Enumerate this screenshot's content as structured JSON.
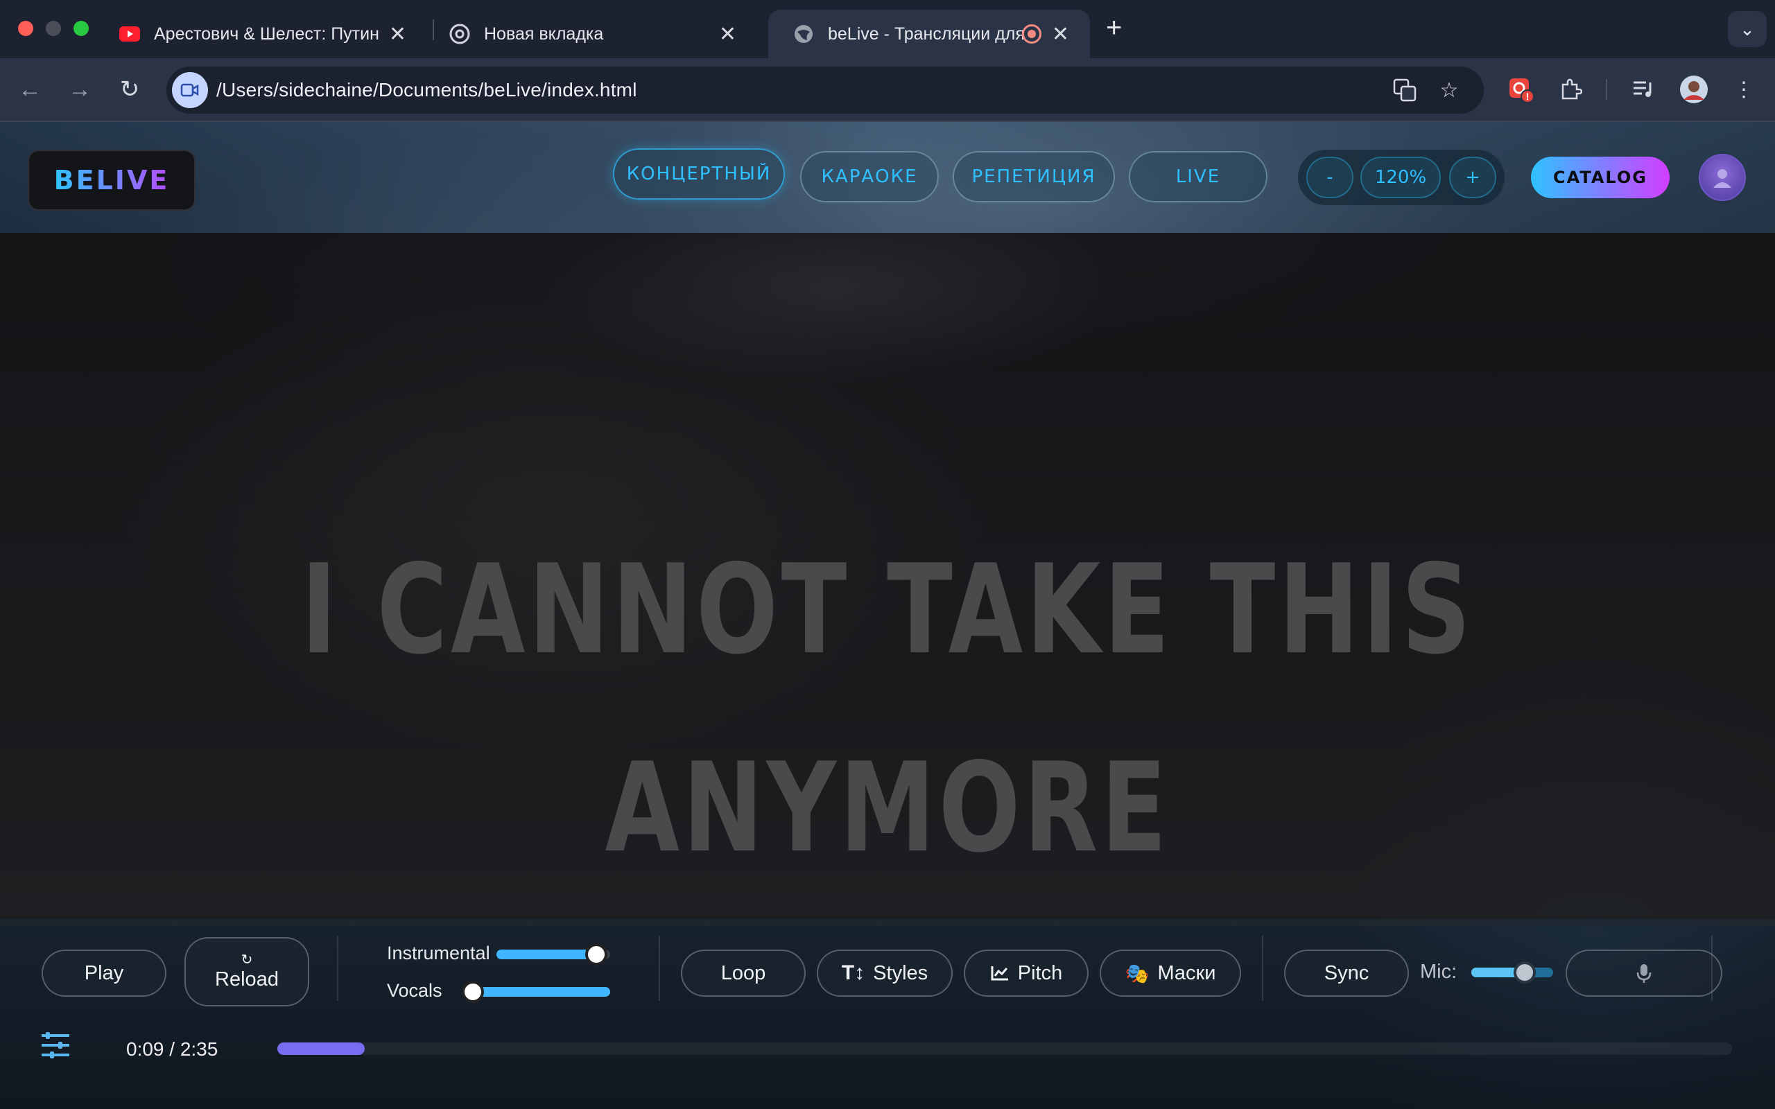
{
  "browser": {
    "tabs": [
      {
        "title": "Арестович & Шелест: Путин",
        "active": false,
        "favicon": "youtube-icon"
      },
      {
        "title": "Новая вкладка",
        "active": false,
        "favicon": "chrome-icon"
      },
      {
        "title": "beLive - Трансляции для",
        "active": true,
        "favicon": "globe-icon"
      }
    ],
    "url": "/Users/sidechaine/Documents/beLive/index.html"
  },
  "header": {
    "logo": "BELIVE",
    "modes": [
      "КОНЦЕРТНЫЙ",
      "КАРАОКЕ",
      "РЕПЕТИЦИЯ",
      "LIVE"
    ],
    "active_mode": "КОНЦЕРТНЫЙ",
    "zoom": {
      "minus": "-",
      "value": "120%",
      "plus": "+"
    },
    "catalog": "CATALOG"
  },
  "lyrics": {
    "line1": "I CANNOT TAKE THIS",
    "line2": "ANYMORE"
  },
  "controls": {
    "play": "Play",
    "reload_icon": "↻",
    "reload": "Reload",
    "instrumental_label": "Instrumental",
    "instrumental_level": 0.88,
    "vocals_label": "Vocals",
    "vocals_level": 0.02,
    "loop": "Loop",
    "styles": "Styles",
    "pitch": "Pitch",
    "masks": "Маски",
    "sync": "Sync",
    "mic_label": "Mic:",
    "mic_level": 0.65,
    "time": "0:09 / 2:35",
    "progress": 0.06
  },
  "colors": {
    "accent": "#2fc0ff",
    "catalog_gradient_start": "#2ec3ff",
    "catalog_gradient_end": "#d23dff",
    "progress": "#7a6cf0",
    "slider": "#3fb6ff"
  }
}
